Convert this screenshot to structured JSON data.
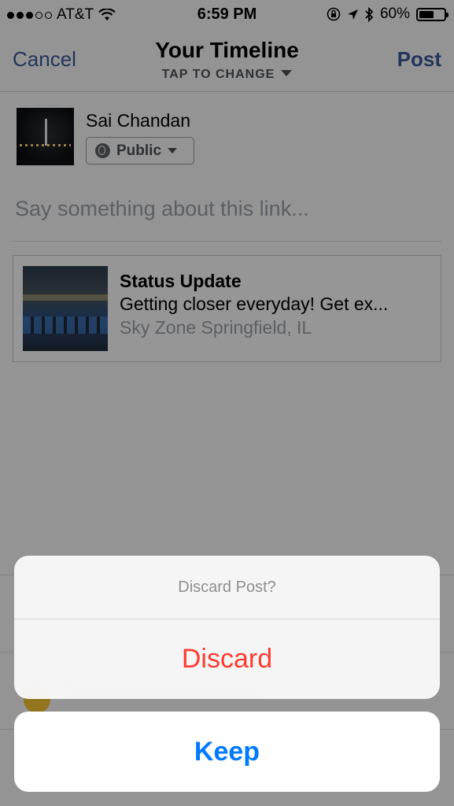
{
  "status_bar": {
    "carrier": "AT&T",
    "time": "6:59 PM",
    "battery": "60%",
    "battery_level": 0.6
  },
  "nav": {
    "cancel_label": "Cancel",
    "title": "Your Timeline",
    "subtitle": "TAP TO CHANGE",
    "post_label": "Post"
  },
  "composer": {
    "user_name": "Sai Chandan",
    "privacy_label": "Public",
    "placeholder": "Say something about this link..."
  },
  "link_preview": {
    "title": "Status Update",
    "description": "Getting closer everyday! Get ex...",
    "location": "Sky Zone Springfield, IL"
  },
  "action_sheet": {
    "title": "Discard Post?",
    "discard_label": "Discard",
    "keep_label": "Keep"
  },
  "colors": {
    "facebook_blue": "#3b5998",
    "destructive_red": "#ff3b30",
    "ios_blue": "#007aff"
  },
  "icons": {
    "wifi": "wifi-icon",
    "lock_rotation": "lock-rotation-icon",
    "location": "location-arrow-icon",
    "bluetooth": "bluetooth-icon",
    "globe": "globe-icon"
  }
}
